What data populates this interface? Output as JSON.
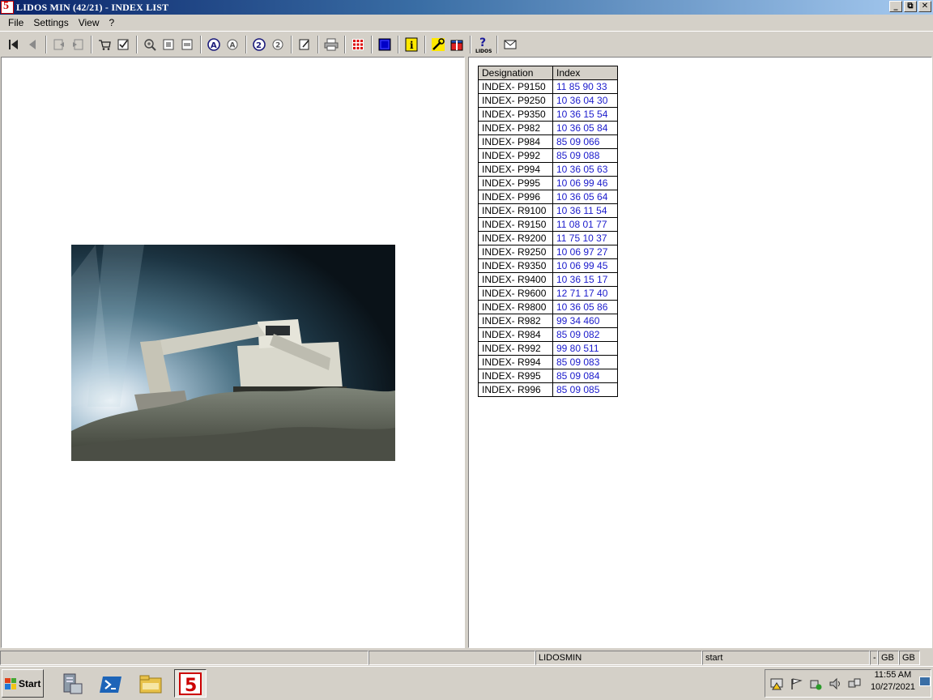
{
  "window": {
    "title": "LIDOS MIN (42/21) - INDEX LIST",
    "app_icon_text": "5",
    "buttons": {
      "minimize": "_",
      "restore": "⧉",
      "close": "✕"
    }
  },
  "menu": [
    {
      "label": "File"
    },
    {
      "label": "Settings"
    },
    {
      "label": "View"
    },
    {
      "label": "?"
    }
  ],
  "toolbar": {
    "icons": [
      "first-page-icon",
      "previous-page-icon",
      "back-history-icon",
      "forward-history-icon",
      "cart-icon",
      "checklist-icon",
      "zoom-in-icon",
      "fit-page-icon",
      "fit-width-icon",
      "search-a-icon",
      "search-a-prev-icon",
      "search-2-icon",
      "search-2-prev-icon",
      "notes-icon",
      "print-icon",
      "grid-icon",
      "blue-square-icon",
      "info-icon",
      "tools-icon",
      "gift-icon",
      "lidos-help-icon",
      "mail-icon"
    ]
  },
  "left_pane": {
    "image": "excavator-photo"
  },
  "index_table": {
    "headers": [
      "Designation",
      "Index"
    ],
    "rows": [
      {
        "designation": "INDEX- P9150",
        "index": "11 85 90 33"
      },
      {
        "designation": "INDEX- P9250",
        "index": "10 36 04 30"
      },
      {
        "designation": "INDEX- P9350",
        "index": "10 36 15 54"
      },
      {
        "designation": "INDEX- P982",
        "index": "10 36 05 84"
      },
      {
        "designation": "INDEX- P984",
        "index": "85 09 066"
      },
      {
        "designation": "INDEX- P992",
        "index": "85 09 088"
      },
      {
        "designation": "INDEX- P994",
        "index": "10 36 05 63"
      },
      {
        "designation": "INDEX- P995",
        "index": "10 06 99 46"
      },
      {
        "designation": "INDEX- P996",
        "index": "10 36 05 64"
      },
      {
        "designation": "INDEX- R9100",
        "index": "10 36 11 54"
      },
      {
        "designation": "INDEX- R9150",
        "index": "11 08 01 77"
      },
      {
        "designation": "INDEX- R9200",
        "index": "11 75 10 37"
      },
      {
        "designation": "INDEX- R9250",
        "index": "10 06 97 27"
      },
      {
        "designation": "INDEX- R9350",
        "index": "10 06 99 45"
      },
      {
        "designation": "INDEX- R9400",
        "index": "10 36 15 17"
      },
      {
        "designation": "INDEX- R9600",
        "index": "12 71 17 40"
      },
      {
        "designation": "INDEX- R9800",
        "index": "10 36 05 86"
      },
      {
        "designation": "INDEX- R982",
        "index": "99 34 460"
      },
      {
        "designation": "INDEX- R984",
        "index": "85 09 082"
      },
      {
        "designation": "INDEX- R992",
        "index": "99 80 511"
      },
      {
        "designation": "INDEX- R994",
        "index": "85 09 083"
      },
      {
        "designation": "INDEX- R995",
        "index": "85 09 084"
      },
      {
        "designation": "INDEX- R996",
        "index": "85 09 085"
      }
    ]
  },
  "statusbar": {
    "cells": [
      "",
      "",
      "LIDOSMIN",
      "start",
      "-",
      "GB",
      "GB"
    ]
  },
  "taskbar": {
    "start_label": "Start",
    "apps": [
      "server-manager-icon",
      "powershell-icon",
      "explorer-folder-icon",
      "lidos-app-icon"
    ],
    "lidos_app_text": "5",
    "time": "11:55 AM",
    "date": "10/27/2021"
  },
  "colors": {
    "index_link": "#1a1acc",
    "titlebar_start": "#0a246a",
    "titlebar_end": "#a6caf0",
    "chrome": "#d4d0c8"
  }
}
